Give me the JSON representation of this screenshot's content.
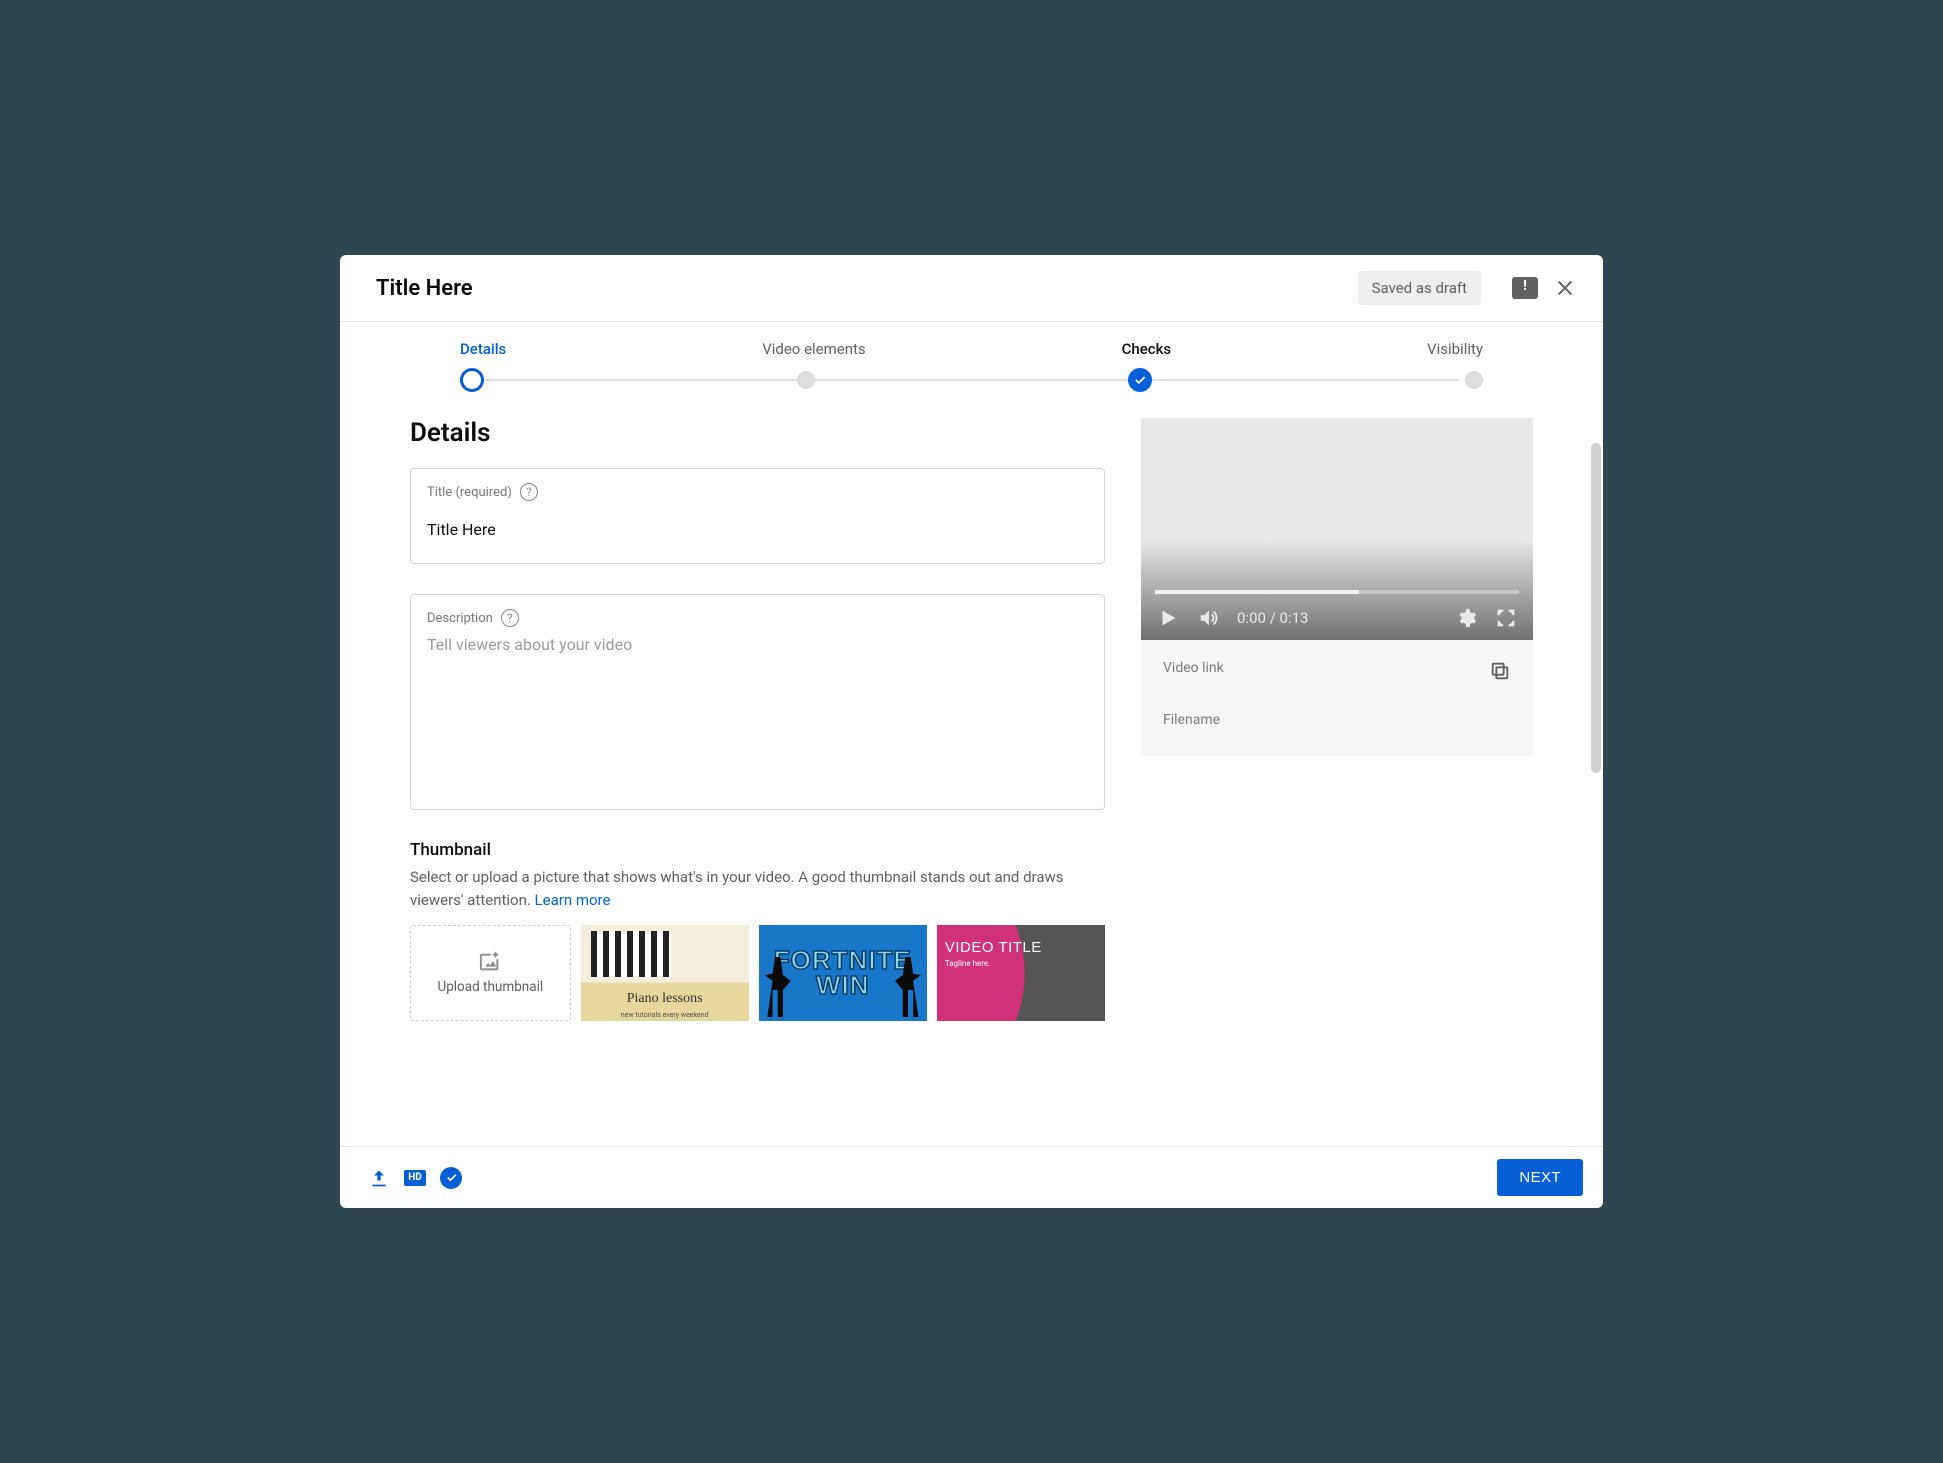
{
  "header": {
    "title": "Title Here",
    "saved_label": "Saved as draft"
  },
  "stepper": {
    "steps": [
      {
        "label": "Details",
        "state": "active"
      },
      {
        "label": "Video elements",
        "state": "pending"
      },
      {
        "label": "Checks",
        "state": "done"
      },
      {
        "label": "Visibility",
        "state": "pending"
      }
    ]
  },
  "details": {
    "heading": "Details",
    "title_field": {
      "label": "Title (required)",
      "value": "Title Here"
    },
    "description_field": {
      "label": "Description",
      "placeholder": "Tell viewers about your video",
      "value": ""
    },
    "thumbnail": {
      "heading": "Thumbnail",
      "desc": "Select or upload a picture that shows what's in your video. A good thumbnail stands out and draws viewers' attention. ",
      "learn_more": "Learn more",
      "upload_label": "Upload thumbnail",
      "suggestions": [
        {
          "caption_top": "Piano lessons",
          "caption_sub": "new tutorials every weekend"
        },
        {
          "big_text": "FORTNITE WIN"
        },
        {
          "title_text": "VIDEO TITLE",
          "tagline": "Tagline here."
        }
      ]
    }
  },
  "preview": {
    "time": "0:00 / 0:13",
    "video_link_label": "Video link",
    "filename_label": "Filename"
  },
  "footer": {
    "hd_label": "HD",
    "next_label": "NEXT"
  }
}
